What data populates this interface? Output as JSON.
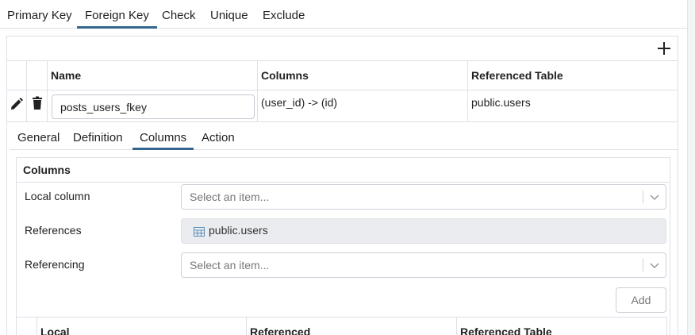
{
  "top_tabs": [
    {
      "label": "Primary Key",
      "active": false
    },
    {
      "label": "Foreign Key",
      "active": true
    },
    {
      "label": "Check",
      "active": false
    },
    {
      "label": "Unique",
      "active": false
    },
    {
      "label": "Exclude",
      "active": false
    }
  ],
  "grid": {
    "add_icon": "plus-icon",
    "headers": [
      "Name",
      "Columns",
      "Referenced Table"
    ],
    "row": {
      "edit_icon": "pencil-icon",
      "delete_icon": "trash-icon",
      "name": "posts_users_fkey",
      "columns": "(user_id) -> (id)",
      "referenced_table": "public.users"
    }
  },
  "sub_tabs": [
    {
      "label": "General",
      "active": false
    },
    {
      "label": "Definition",
      "active": false
    },
    {
      "label": "Columns",
      "active": true
    },
    {
      "label": "Action",
      "active": false
    }
  ],
  "columns_panel": {
    "title": "Columns",
    "local_column": {
      "label": "Local column",
      "placeholder": "Select an item..."
    },
    "references": {
      "label": "References",
      "value": "public.users",
      "icon": "table-icon"
    },
    "referencing": {
      "label": "Referencing",
      "placeholder": "Select an item..."
    },
    "add_button": "Add",
    "table_headers": [
      "Local",
      "Referenced",
      "Referenced Table"
    ]
  },
  "colors": {
    "accent": "#326690",
    "border": "#dde0e6",
    "readonly_bg": "#eaecef"
  }
}
